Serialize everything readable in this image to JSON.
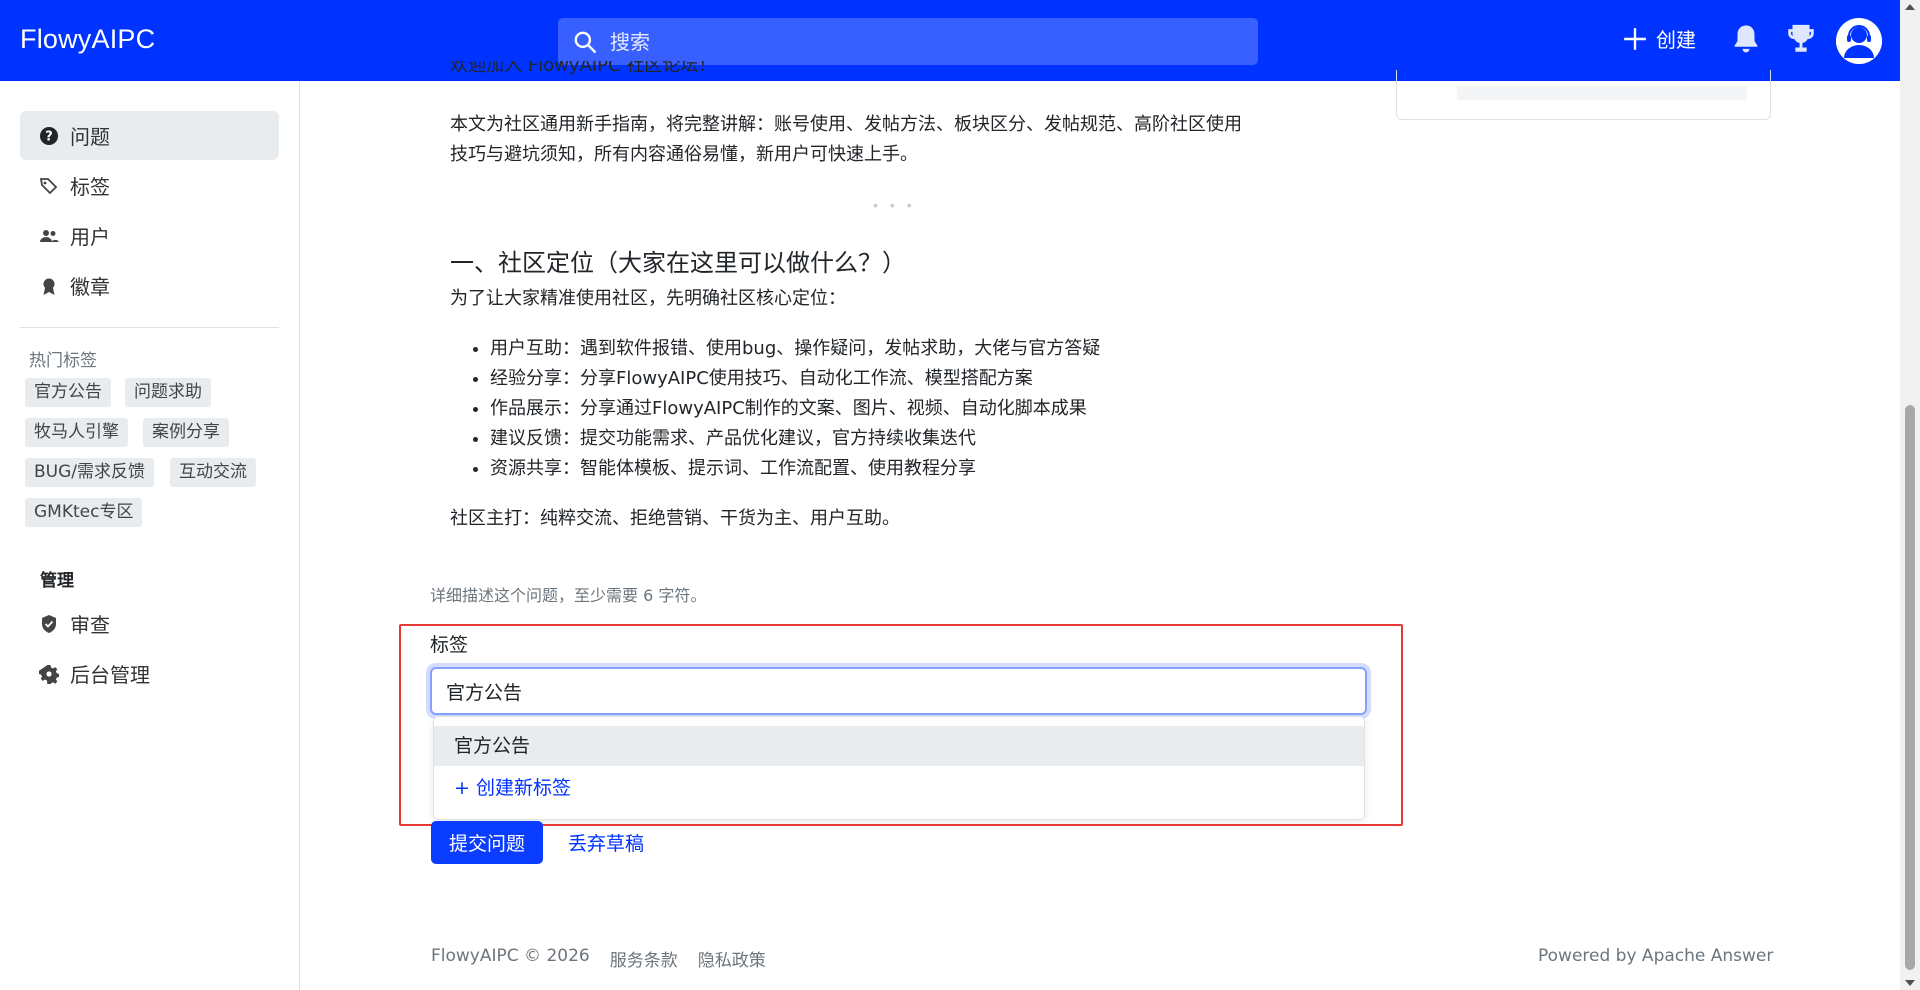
{
  "header": {
    "brand": "FlowyAIPC",
    "search_placeholder": "搜索",
    "create_label": "创建",
    "bg_color": "#0033ff"
  },
  "sidebar": {
    "nav": [
      {
        "label": "问题",
        "icon": "question-circle-icon",
        "active": true
      },
      {
        "label": "标签",
        "icon": "tags-icon"
      },
      {
        "label": "用户",
        "icon": "people-icon"
      },
      {
        "label": "徽章",
        "icon": "award-icon"
      }
    ],
    "hot_tags_title": "热门标签",
    "hot_tags": [
      "官方公告",
      "问题求助",
      "牧马人引擎",
      "案例分享",
      "BUG/需求反馈",
      "互动交流",
      "GMKtec专区"
    ],
    "manage_title": "管理",
    "manage": [
      {
        "label": "审查",
        "icon": "shield-check-icon"
      },
      {
        "label": "后台管理",
        "icon": "gear-icon"
      }
    ]
  },
  "post": {
    "partial_top_line": "欢迎加入 FlowyAIPC 社区论坛！",
    "intro": "本文为社区通用新手指南，将完整讲解：账号使用、发帖方法、板块区分、发帖规范、高阶社区使用技巧与避坑须知，所有内容通俗易懂，新用户可快速上手。",
    "intro_line1": "本文为社区通用新手指南，将完整讲解：账号使用、发帖方法、板块区分、发帖规范、高阶社区使用",
    "intro_line2": "技巧与避坑须知，所有内容通俗易懂，新用户可快速上手。",
    "section_title": "一、社区定位（大家在这里可以做什么？）",
    "section_lead": "为了让大家精准使用社区，先明确社区核心定位：",
    "bullets": [
      "用户互助：遇到软件报错、使用bug、操作疑问，发帖求助，大佬与官方答疑",
      "经验分享：分享FlowyAIPC使用技巧、自动化工作流、模型搭配方案",
      "作品展示：分享通过FlowyAIPC制作的文案、图片、视频、自动化脚本成果",
      "建议反馈：提交功能需求、产品优化建议，官方持续收集迭代",
      "资源共享：智能体模板、提示词、工作流配置、使用教程分享"
    ],
    "closing": "社区主打：纯粹交流、拒绝营销、干货为主、用户互助。"
  },
  "form": {
    "hint": "详细描述这个问题，至少需要 6 字符。",
    "tags_label": "标签",
    "tags_value": "官方公告",
    "dropdown": {
      "suggestion": "官方公告",
      "create_new": "+ 创建新标签"
    },
    "submit_label": "提交问题",
    "discard_label": "丢弃草稿"
  },
  "footer": {
    "copyright": "FlowyAIPC © 2026",
    "terms": "服务条款",
    "privacy": "隐私政策",
    "powered": "Powered by Apache Answer"
  },
  "colors": {
    "accent": "#0033ff",
    "highlight_box": "#e53935"
  }
}
